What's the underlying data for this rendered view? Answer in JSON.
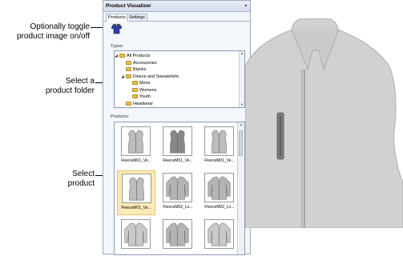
{
  "callouts": {
    "toggle": [
      "Optionally toggle",
      "product image on/off"
    ],
    "folder": [
      "Select a",
      "product folder"
    ],
    "product": [
      "Select",
      "product"
    ]
  },
  "panel": {
    "title": "Product Visualizer",
    "pin_icon": "pin-icon",
    "tabs": [
      "Products",
      "Settings"
    ],
    "active_tab": "Products"
  },
  "types": {
    "label": "Types:",
    "items": [
      {
        "label": "All Products",
        "level": 0,
        "expander": "minus"
      },
      {
        "label": "Accessories",
        "level": 1
      },
      {
        "label": "Blanks",
        "level": 1
      },
      {
        "label": "Fleece and Sweatshirts",
        "level": 1,
        "expander": "minus"
      },
      {
        "label": "Mens",
        "level": 2
      },
      {
        "label": "Womens",
        "level": 2
      },
      {
        "label": "Youth",
        "level": 2
      },
      {
        "label": "Headwear",
        "level": 1
      }
    ]
  },
  "products": {
    "label": "Products:",
    "items": [
      {
        "label": "FleeceM01_Ve...",
        "kind": "vest-front",
        "selected": false
      },
      {
        "label": "FleeceM01_Ve...",
        "kind": "vest-dark",
        "selected": false
      },
      {
        "label": "FleeceM01_Ve...",
        "kind": "vest-side",
        "selected": false
      },
      {
        "label": "FleeceM01_Ve...",
        "kind": "vest-collar",
        "selected": true
      },
      {
        "label": "FleeceM02_Lo...",
        "kind": "jacket",
        "selected": false
      },
      {
        "label": "FleeceM02_Lo...",
        "kind": "jacket-back",
        "selected": false
      },
      {
        "label": "",
        "kind": "jacket-2",
        "selected": false
      },
      {
        "label": "",
        "kind": "jacket",
        "selected": false
      },
      {
        "label": "",
        "kind": "jacket-2",
        "selected": false
      }
    ]
  },
  "colors": {
    "panel_border": "#9aa9c2",
    "selection": "#fcebb5",
    "fleece": "#d3d3d3",
    "folder": "#e8c04c"
  }
}
